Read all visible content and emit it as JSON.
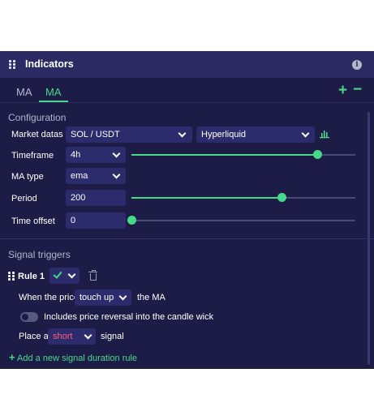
{
  "header": {
    "title": "Indicators",
    "info_icon": "i"
  },
  "tabs": [
    {
      "label": "MA"
    },
    {
      "label": "MA",
      "active": true
    }
  ],
  "tab_actions": {
    "add": "+",
    "remove": "−"
  },
  "configuration": {
    "title": "Configuration",
    "market_label": "Market datas",
    "market_value": "SOL / USDT",
    "exchange_value": "Hyperliquid",
    "timeframe_label": "Timeframe",
    "timeframe_value": "4h",
    "timeframe_slider_level": 0.83,
    "ma_type_label": "MA type",
    "ma_type_value": "ema",
    "period_label": "Period",
    "period_value": "200",
    "period_slider_level": 0.67,
    "time_offset_label": "Time offset",
    "time_offset_value": "0",
    "time_offset_slider_level": 0.0
  },
  "signal_triggers": {
    "title": "Signal triggers",
    "rule_title": "Rule 1",
    "when_text": "When the price",
    "condition_value": "touch up",
    "the_ma_text": "the MA",
    "wick_toggle_label": "Includes price reversal into the candle wick",
    "wick_toggle_on": false,
    "place_text": "Place a",
    "signal_value": "short",
    "signal_text": "signal",
    "add_rule_label": "Add a new signal duration rule"
  },
  "colors": {
    "panel_bg": "#1d1c46",
    "header_bg": "#2b2a63",
    "field_bg": "#2c2b6b",
    "accent": "#47d98a",
    "short": "#ff5d7e"
  }
}
